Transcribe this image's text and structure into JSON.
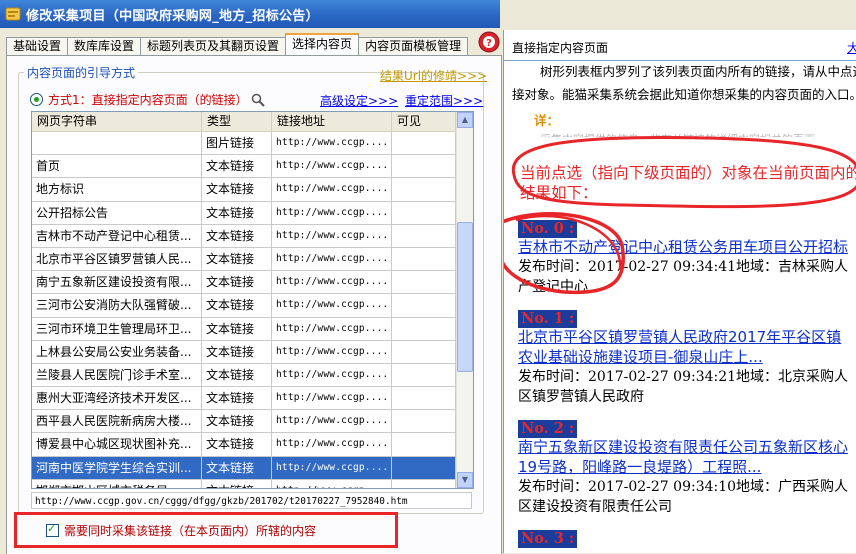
{
  "window": {
    "title": "修改采集项目（中国政府采购网_地方_招标公告）"
  },
  "tabs": [
    {
      "label": "基础设置",
      "active": false
    },
    {
      "label": "数库库设置",
      "active": false
    },
    {
      "label": "标题列表页及其翻页设置",
      "active": false
    },
    {
      "label": "选择内容页",
      "active": true
    },
    {
      "label": "内容页面模板管理",
      "active": false
    }
  ],
  "group": {
    "legend": "内容页面的引导方式",
    "result_link": "结果Url的修靖>>>",
    "method_label": "方式1：直接指定内容页面（的链接）",
    "advanced_link": "高级设定>>>",
    "range_link": "重定范围>>>"
  },
  "list": {
    "columns": [
      "网页字符串",
      "类型",
      "链接地址",
      "可见"
    ],
    "rows": [
      {
        "text": "",
        "type": "图片链接",
        "url": "http://www.ccgp....",
        "visible": "",
        "selected": false
      },
      {
        "text": "首页",
        "type": "文本链接",
        "url": "http://www.ccgp....",
        "visible": "",
        "selected": false
      },
      {
        "text": "地方标识",
        "type": "文本链接",
        "url": "http://www.ccgp....",
        "visible": "",
        "selected": false
      },
      {
        "text": "公开招标公告",
        "type": "文本链接",
        "url": "http://www.ccgp....",
        "visible": "",
        "selected": false
      },
      {
        "text": "吉林市不动产登记中心租赁...",
        "type": "文本链接",
        "url": "http://www.ccgp....",
        "visible": "",
        "selected": false
      },
      {
        "text": "北京市平谷区镇罗营镇人民...",
        "type": "文本链接",
        "url": "http://www.ccgp....",
        "visible": "",
        "selected": false
      },
      {
        "text": "南宁五象新区建设投资有限...",
        "type": "文本链接",
        "url": "http://www.ccgp....",
        "visible": "",
        "selected": false
      },
      {
        "text": "三河市公安消防大队强臂破...",
        "type": "文本链接",
        "url": "http://www.ccgp....",
        "visible": "",
        "selected": false
      },
      {
        "text": "三河市环境卫生管理局环卫...",
        "type": "文本链接",
        "url": "http://www.ccgp....",
        "visible": "",
        "selected": false
      },
      {
        "text": "上林县公安局公安业务装备...",
        "type": "文本链接",
        "url": "http://www.ccgp....",
        "visible": "",
        "selected": false
      },
      {
        "text": "兰陵县人民医院门诊手术室...",
        "type": "文本链接",
        "url": "http://www.ccgp....",
        "visible": "",
        "selected": false
      },
      {
        "text": "惠州大亚湾经济技术开发区...",
        "type": "文本链接",
        "url": "http://www.ccgp....",
        "visible": "",
        "selected": false
      },
      {
        "text": "西平县人民医院新病房大楼...",
        "type": "文本链接",
        "url": "http://www.ccgp....",
        "visible": "",
        "selected": false
      },
      {
        "text": "博爱县中心城区现状图补充...",
        "type": "文本链接",
        "url": "http://www.ccgp....",
        "visible": "",
        "selected": false
      },
      {
        "text": "河南中医学院学生综合实训...",
        "type": "文本链接",
        "url": "http://www.ccgp....",
        "visible": "",
        "selected": true
      },
      {
        "text": "邯郸市邯山区城市税务局...",
        "type": "文本链接",
        "url": "http://www.ccgp....",
        "visible": "",
        "selected": false
      }
    ]
  },
  "selected_url": "http://www.ccgp.gov.cn/cggg/dfgg/gkzb/201702/t20170227_7952840.htm",
  "checkbox": {
    "label": "需要同时采集该链接（在本页面内）所辖的内容",
    "checked": true
  },
  "preview": {
    "header_title": "直接指定内容页面",
    "header_link": "大",
    "intro_line1": "树形列表框内罗列了该列表页面内所有的链接，请从中点选指",
    "intro_line2": "接对象。能猫采集系统会据此知道你想采集的内容页面的入口。",
    "detail_label": "详：",
    "detail_text": "采集内容提供的信息一些有关链接的详细内容相关的页面",
    "result_line1": "当前点选（指向下级页面的）对象在当前页面内的",
    "result_line2": "结果如下：",
    "items": [
      {
        "no": "No. 0 :",
        "title_lines": [
          "吉林市不动产登记中心租赁公务用车项目公开招标"
        ],
        "meta_lines": [
          "发布时间：2017-02-27 09:34:41地域：吉林采购人",
          "产登记中心"
        ]
      },
      {
        "no": "No. 1 :",
        "title_lines": [
          "北京市平谷区镇罗营镇人民政府2017年平谷区镇",
          "农业基础设施建设项目-御泉山庄上..."
        ],
        "meta_lines": [
          "发布时间：2017-02-27 09:34:21地域：北京采购人",
          "区镇罗营镇人民政府"
        ]
      },
      {
        "no": "No. 2 :",
        "title_lines": [
          "南宁五象新区建设投资有限责任公司五象新区核心",
          "19号路，阳峰路一良堤路）工程照..."
        ],
        "meta_lines": [
          "发布时间：2017-02-27 09:34:10地域：广西采购人",
          "区建设投资有限责任公司"
        ]
      },
      {
        "no": "No. 3 :",
        "title_lines": [],
        "meta_lines": []
      }
    ]
  },
  "colors": {
    "accent_red": "#e8262a",
    "link_blue": "#0d2fcc",
    "selection_blue": "#316ac5",
    "titlebar_blue": "#2a66c4"
  },
  "icons": {
    "app": "app-icon",
    "help": "help-icon",
    "search": "magnifier-icon"
  }
}
